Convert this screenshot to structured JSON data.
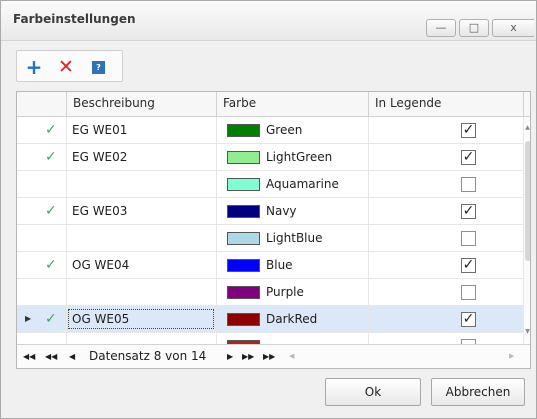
{
  "window": {
    "title": "Farbeinstellungen",
    "minimize_glyph": "—",
    "maximize_glyph": "□",
    "close_glyph": "x"
  },
  "toolbar": {
    "add_glyph": "+",
    "delete_glyph": "✕",
    "help_glyph": "?"
  },
  "grid": {
    "columns": [
      "Beschreibung",
      "Farbe",
      "In Legende"
    ],
    "rows": [
      {
        "check": "✓",
        "beschreibung": "EG WE01",
        "color_name": "Green",
        "color_hex": "#008000",
        "in_legend": "✓"
      },
      {
        "check": "✓",
        "beschreibung": "EG WE02",
        "color_name": "LightGreen",
        "color_hex": "#90ee90",
        "in_legend": "✓"
      },
      {
        "check": "",
        "beschreibung": "",
        "color_name": "Aquamarine",
        "color_hex": "#7fffd4",
        "in_legend": ""
      },
      {
        "check": "✓",
        "beschreibung": "EG WE03",
        "color_name": "Navy",
        "color_hex": "#000080",
        "in_legend": "✓"
      },
      {
        "check": "",
        "beschreibung": "",
        "color_name": "LightBlue",
        "color_hex": "#add8e6",
        "in_legend": ""
      },
      {
        "check": "✓",
        "beschreibung": "OG WE04",
        "color_name": "Blue",
        "color_hex": "#0000ff",
        "in_legend": "✓"
      },
      {
        "check": "",
        "beschreibung": "",
        "color_name": "Purple",
        "color_hex": "#800080",
        "in_legend": ""
      },
      {
        "check": "✓",
        "beschreibung": "OG WE05",
        "color_name": "DarkRed",
        "color_hex": "#8b0000",
        "in_legend": "✓",
        "current": "▶"
      },
      {
        "check": "",
        "beschreibung": "",
        "color_name": "",
        "color_hex": "#b22222",
        "in_legend": ""
      }
    ],
    "selected_row_index": 7,
    "navigator": {
      "first": "◀◀",
      "prev_page": "◀◀",
      "prev": "◀",
      "record_text": "Datensatz 8 von 14",
      "next": "▶",
      "next_page": "▶▶",
      "last": "▶▶"
    }
  },
  "buttons": {
    "ok": "Ok",
    "cancel": "Abbrechen"
  },
  "colors": {
    "check_green": "#39a86a",
    "selected_row": "#dbe8f8",
    "add_blue": "#1d73c6",
    "delete_red": "#d9262b"
  }
}
